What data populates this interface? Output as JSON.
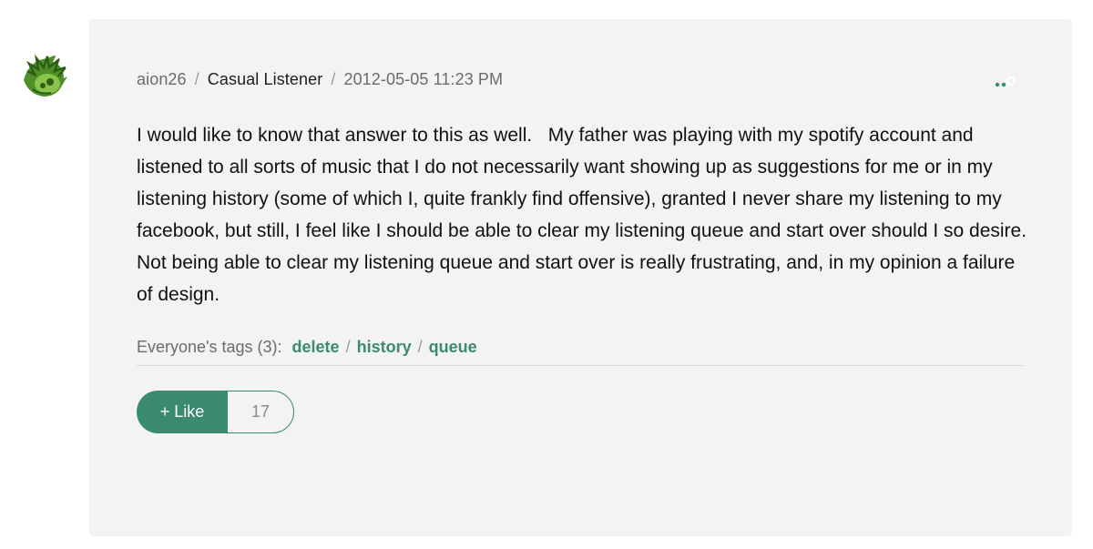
{
  "post": {
    "author": "aion26",
    "rank": "Casual Listener",
    "timestamp": "2012-05-05 11:23 PM",
    "separator": "/",
    "body_lines": [
      "I would like to know that answer to this as well.   My father was playing with my spotify account and",
      "listened to all sorts of music that I do not necessarily want showing up as suggestions for me or in my",
      "listening history (some of which I, quite frankly find offensive), granted I never share my listening to my",
      "facebook, but still, I feel like I should be able to clear my listening queue and start over should I so desire.",
      "Not being able to clear my listening queue and start over is really frustrating, and, in my opinion a failure",
      "of design."
    ]
  },
  "tags": {
    "label": "Everyone's tags (3):",
    "items": [
      "delete",
      "history",
      "queue"
    ],
    "separator": "/"
  },
  "like": {
    "label": "+ Like",
    "count": "17"
  },
  "icons": {
    "avatar": "avatar-icon",
    "options": "more-options-icon"
  },
  "colors": {
    "accent": "#3a8a6e",
    "tag": "#3d8a6f",
    "card_bg": "#f3f3f3"
  }
}
